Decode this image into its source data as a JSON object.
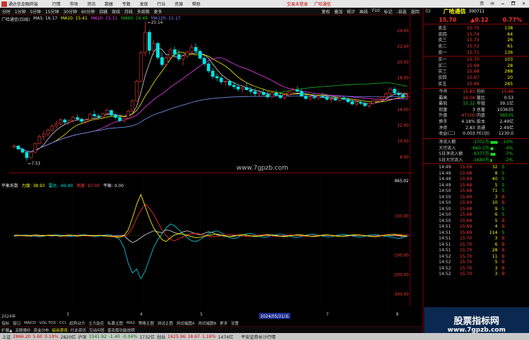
{
  "window": {
    "title": "通达信金融终端",
    "menu": [
      "行情",
      "市场",
      "资讯",
      "数据",
      "专题",
      "发现",
      "行业",
      "资源",
      "帮助"
    ],
    "center": [
      "交易未登录",
      "广哈通信"
    ],
    "controls": [
      "资",
      "✉",
      "🗕",
      "🗖",
      "✕"
    ]
  },
  "toolbar": {
    "items": [
      "分时",
      "1分钟",
      "5分钟",
      "15分钟",
      "30分钟",
      "60分钟",
      "日线",
      "周线",
      "月线",
      "多周期",
      "更多"
    ],
    "right": [
      "复权",
      "叠加",
      "统计",
      "画线",
      "F10",
      "标记",
      "-自选",
      "返回"
    ]
  },
  "main_chart_info": {
    "name": "广哈通信(日线)",
    "ma5": "MA5: 16.17",
    "ma10": "MA10: 15.41",
    "ma20": "MA20: 15.11",
    "ma60": "MA60: 16.49",
    "ma120": "MA120: 15.17",
    "high_label": "25.14",
    "low_label": "7.53",
    "watermark": "www.7gpzb.com",
    "ylabels": [
      "24.00",
      "22.00",
      "20.00",
      "18.00",
      "16.00",
      "14.00",
      "12.00",
      "10.00",
      "8.00"
    ]
  },
  "sub_chart_info": {
    "name": "平衡系数",
    "a_label": "力度: 38.93",
    "b_label": "雷达: -69.90",
    "c_label": "刺客: 97.00",
    "d_label": "平衡: 0.00",
    "ylabels": [
      "865.02",
      "100.00",
      "0.00",
      "-100.00",
      "-200.00",
      "-300.00"
    ]
  },
  "stock": {
    "number": "02",
    "name": "广哈通信",
    "code": "300711",
    "price": "15.70",
    "change": "▲0.12",
    "pct": "0.77%"
  },
  "asks": [
    {
      "label": "卖五",
      "price": "15.75",
      "vol": "138"
    },
    {
      "label": "卖四",
      "price": "15.74",
      "vol": "64"
    },
    {
      "label": "卖三",
      "price": "15.73",
      "vol": "26"
    },
    {
      "label": "卖二",
      "price": "15.72",
      "vol": "61"
    },
    {
      "label": "卖一",
      "price": "15.71",
      "vol": "136"
    }
  ],
  "bids": [
    {
      "label": "买一",
      "price": "15.70",
      "vol": "103"
    },
    {
      "label": "买二",
      "price": "15.69",
      "vol": "28"
    },
    {
      "label": "买三",
      "price": "15.68",
      "vol": "288"
    },
    {
      "label": "买四",
      "price": "15.67",
      "vol": "20"
    },
    {
      "label": "买五",
      "price": "15.66",
      "vol": "265"
    }
  ],
  "quote": [
    {
      "k1": "今开",
      "v1": "15.83",
      "k2": "均价",
      "v2": "15.66"
    },
    {
      "k1": "最高",
      "v1": "16.04",
      "k2": "量比",
      "v2": "0.53"
    },
    {
      "k1": "最低",
      "v1": "15.22",
      "k2": "市值",
      "v2": "39.1亿"
    },
    {
      "k1": "现量",
      "v1": "3",
      "k2": "总量",
      "v2": "103635"
    },
    {
      "k1": "外盘",
      "v1": "47100",
      "k2": "内盘",
      "v2": "56535"
    },
    {
      "k1": "换手",
      "v1": "4.18%",
      "k2": "股本",
      "v2": "2.49亿"
    },
    {
      "k1": "净资",
      "v1": "2.83",
      "k2": "流通",
      "v2": "2.49亿"
    },
    {
      "k1": "收益(二)",
      "v1": "0.003",
      "k2": "PE(动)",
      "v2": "1230.0"
    }
  ],
  "flows": [
    {
      "k": "净流入额",
      "v": "-1701万",
      "p": "-10%"
    },
    {
      "k": "大宗流入",
      "v": "-660.3万",
      "p": "-4%"
    },
    {
      "k": "5日净流入额",
      "v": "-6377万",
      "p": "-7%"
    },
    {
      "k": "5日大宗流入",
      "v": "-1680万",
      "p": "-2%"
    }
  ],
  "ticks": [
    {
      "t": "14:49",
      "p": "15.69",
      "v": "32",
      "s": "S"
    },
    {
      "t": "14:49",
      "p": "15.68",
      "v": "8",
      "s": "S"
    },
    {
      "t": "14:49",
      "p": "15.69",
      "v": "40",
      "s": "S"
    },
    {
      "t": "14:49",
      "p": "15.68",
      "v": "5",
      "s": "S"
    },
    {
      "t": "14:50",
      "p": "15.68",
      "v": "71",
      "s": "S"
    },
    {
      "t": "14:50",
      "p": "15.69",
      "v": "3",
      "s": "B"
    },
    {
      "t": "14:50",
      "p": "15.69",
      "v": "10",
      "s": "B"
    },
    {
      "t": "14:50",
      "p": "15.68",
      "v": "9",
      "s": "S"
    },
    {
      "t": "14:50",
      "p": "15.68",
      "v": "6",
      "s": "S"
    },
    {
      "t": "14:50",
      "p": "15.69",
      "v": "5",
      "s": "B"
    },
    {
      "t": "14:51",
      "p": "15.69",
      "v": "4",
      "s": "B"
    },
    {
      "t": "14:51",
      "p": "15.69",
      "v": "114",
      "s": "S"
    },
    {
      "t": "14:51",
      "p": "15.70",
      "v": "3",
      "s": "B"
    },
    {
      "t": "14:51",
      "p": "15.70",
      "v": "6",
      "s": "B"
    },
    {
      "t": "14:51",
      "p": "15.70",
      "v": "28",
      "s": "B"
    },
    {
      "t": "14:52",
      "p": "15.70",
      "v": "11",
      "s": "B"
    },
    {
      "t": "14:52",
      "p": "15.70",
      "v": "5",
      "s": "B"
    },
    {
      "t": "14:52",
      "p": "15.70",
      "v": "3",
      "s": "B"
    },
    {
      "t": "14:52",
      "p": "15.70",
      "v": "3",
      "s": "B"
    }
  ],
  "date_bar": {
    "year": "2024年",
    "m3": "3",
    "m4": "4",
    "m5": "5",
    "cursor_date": "2024/05/31/五",
    "m7": "7",
    "m8": "8"
  },
  "bottom_tabs": [
    "指标",
    "窗口",
    "MACD",
    "VOL-TDX",
    "CCI",
    "趋势动力",
    "主力监控",
    "私募主图",
    "MA2",
    "策略主图",
    "测试主图",
    "测式幅图A",
    "测式幅图B",
    "更多",
    "设置"
  ],
  "bottom_tabs2": [
    "扩展▲",
    "关联报价",
    "资金分布",
    "综合资讯",
    "行业资讯",
    "互动问答",
    "普及版功能说明"
  ],
  "status": {
    "sh_label": "上证",
    "sh_val": "2866.20",
    "sh_chg": "5.60",
    "sh_pct": "0.19%",
    "sh_amt": "2820亿",
    "sz_label": "沪深",
    "sz_val": "3341.92",
    "sz_chg": "-1.40",
    "sz_pct": "-0.04%",
    "sz_amt": "1732亿",
    "cy_label": "创业",
    "cy_val": "1625.96",
    "cy_chg": "18.67",
    "cy_pct": "1.16%",
    "cy_amt": "1474亿",
    "broker": "平安证券长沙行情"
  },
  "watermark": {
    "line1": "股票指标网",
    "line2": "www.7gpzb.com"
  },
  "chart_data": {
    "type": "line",
    "candles": [
      [
        9.3,
        9.6,
        9.0,
        9.4
      ],
      [
        9.4,
        9.5,
        8.9,
        9.0
      ],
      [
        9.0,
        9.2,
        8.4,
        8.6
      ],
      [
        8.6,
        8.8,
        7.53,
        7.9
      ],
      [
        7.9,
        8.7,
        7.8,
        8.6
      ],
      [
        8.6,
        9.8,
        8.5,
        9.7
      ],
      [
        9.7,
        10.8,
        9.6,
        10.6
      ],
      [
        10.6,
        11.3,
        10.2,
        10.9
      ],
      [
        10.9,
        11.6,
        10.6,
        11.4
      ],
      [
        11.4,
        12.1,
        11.2,
        11.9
      ],
      [
        11.9,
        12.6,
        11.7,
        12.2
      ],
      [
        12.2,
        12.9,
        12.0,
        12.7
      ],
      [
        12.7,
        12.9,
        12.2,
        12.4
      ],
      [
        12.4,
        12.8,
        12.1,
        12.6
      ],
      [
        12.6,
        13.2,
        12.4,
        13.0
      ],
      [
        13.0,
        13.4,
        12.6,
        12.8
      ],
      [
        12.8,
        13.0,
        12.3,
        12.5
      ],
      [
        12.5,
        12.9,
        12.2,
        12.7
      ],
      [
        12.7,
        13.6,
        12.6,
        13.4
      ],
      [
        13.4,
        13.9,
        13.0,
        13.2
      ],
      [
        13.2,
        13.5,
        12.9,
        13.1
      ],
      [
        13.1,
        13.6,
        13.0,
        13.5
      ],
      [
        13.5,
        14.2,
        13.3,
        13.9
      ],
      [
        13.9,
        14.0,
        13.1,
        13.3
      ],
      [
        13.3,
        13.6,
        12.8,
        13.0
      ],
      [
        13.0,
        13.4,
        12.4,
        12.6
      ],
      [
        12.6,
        13.1,
        12.3,
        12.9
      ],
      [
        12.9,
        14.0,
        12.8,
        13.8
      ],
      [
        13.8,
        15.3,
        13.7,
        15.1
      ],
      [
        15.1,
        17.8,
        15.0,
        17.6
      ],
      [
        17.6,
        21.4,
        17.5,
        21.2
      ],
      [
        21.2,
        25.14,
        20.8,
        23.8
      ],
      [
        23.8,
        24.1,
        21.0,
        21.5
      ],
      [
        21.5,
        22.8,
        20.9,
        22.4
      ],
      [
        22.4,
        22.6,
        20.3,
        20.6
      ],
      [
        20.6,
        21.3,
        19.4,
        19.7
      ],
      [
        19.7,
        20.8,
        19.5,
        20.6
      ],
      [
        20.6,
        21.9,
        20.4,
        21.6
      ],
      [
        21.6,
        22.0,
        20.7,
        21.0
      ],
      [
        21.0,
        21.6,
        20.1,
        20.4
      ],
      [
        20.4,
        21.0,
        19.6,
        20.8
      ],
      [
        20.8,
        21.5,
        20.5,
        21.3
      ],
      [
        21.3,
        22.3,
        21.0,
        21.9
      ],
      [
        21.9,
        22.4,
        21.1,
        21.4
      ],
      [
        21.4,
        21.7,
        20.3,
        20.5
      ],
      [
        20.5,
        20.9,
        19.5,
        19.8
      ],
      [
        19.8,
        20.1,
        18.6,
        18.9
      ],
      [
        18.9,
        19.3,
        17.9,
        18.2
      ],
      [
        18.2,
        18.6,
        17.6,
        18.0
      ],
      [
        18.0,
        18.3,
        17.2,
        17.5
      ],
      [
        17.5,
        17.9,
        17.0,
        17.6
      ],
      [
        17.6,
        17.8,
        16.9,
        17.1
      ],
      [
        17.1,
        17.5,
        16.6,
        16.9
      ],
      [
        16.9,
        17.2,
        16.3,
        16.6
      ],
      [
        16.6,
        17.0,
        16.2,
        16.8
      ],
      [
        16.8,
        17.4,
        16.5,
        16.5
      ],
      [
        16.5,
        16.9,
        16.0,
        16.3
      ],
      [
        16.3,
        16.7,
        15.7,
        16.0
      ],
      [
        16.0,
        16.4,
        15.6,
        16.2
      ],
      [
        16.2,
        16.6,
        15.8,
        15.9
      ],
      [
        15.9,
        16.3,
        15.4,
        15.6
      ],
      [
        15.6,
        16.2,
        15.5,
        16.1
      ],
      [
        16.1,
        16.5,
        15.7,
        15.8
      ],
      [
        15.8,
        16.2,
        15.4,
        15.5
      ],
      [
        15.5,
        16.0,
        15.3,
        15.9
      ],
      [
        15.9,
        16.4,
        15.6,
        16.2
      ],
      [
        16.2,
        16.8,
        15.9,
        16.5
      ],
      [
        16.5,
        17.0,
        16.2,
        16.3
      ],
      [
        16.3,
        16.6,
        15.6,
        15.7
      ],
      [
        15.7,
        16.0,
        15.2,
        15.4
      ],
      [
        15.4,
        15.8,
        15.1,
        15.6
      ],
      [
        15.6,
        16.0,
        15.3,
        15.5
      ],
      [
        15.5,
        15.9,
        15.2,
        15.7
      ],
      [
        15.7,
        16.1,
        15.5,
        15.6
      ],
      [
        15.6,
        15.8,
        15.1,
        15.3
      ],
      [
        15.3,
        15.6,
        14.9,
        15.4
      ],
      [
        15.4,
        15.7,
        15.1,
        15.2
      ],
      [
        15.2,
        15.6,
        15.0,
        15.5
      ],
      [
        15.5,
        15.8,
        15.2,
        15.3
      ],
      [
        15.3,
        15.5,
        14.8,
        15.0
      ],
      [
        15.0,
        15.3,
        14.6,
        14.7
      ],
      [
        14.7,
        15.1,
        14.4,
        14.9
      ],
      [
        14.9,
        15.2,
        14.6,
        14.8
      ],
      [
        14.8,
        15.0,
        14.3,
        14.5
      ],
      [
        14.5,
        14.9,
        14.2,
        14.8
      ],
      [
        14.8,
        15.2,
        14.6,
        15.1
      ],
      [
        15.1,
        15.5,
        14.9,
        15.3
      ],
      [
        15.3,
        15.7,
        15.1,
        15.6
      ],
      [
        15.6,
        16.2,
        15.5,
        16.0
      ],
      [
        16.0,
        16.9,
        15.8,
        16.6
      ],
      [
        16.6,
        16.9,
        15.9,
        16.1
      ],
      [
        16.1,
        16.4,
        15.5,
        15.9
      ],
      [
        15.9,
        16.1,
        15.3,
        15.6
      ],
      [
        15.6,
        16.04,
        15.22,
        15.7
      ]
    ],
    "osc": {
      "yellow": [
        2,
        3,
        1,
        -2,
        1,
        4,
        2,
        -1,
        3,
        2,
        0,
        -3,
        1,
        4,
        2,
        -2,
        1,
        3,
        0,
        -1,
        2,
        1,
        -2,
        -4,
        -6,
        -8,
        0,
        30,
        90,
        160,
        210,
        150,
        90,
        40,
        10,
        -20,
        -30,
        -10,
        5,
        10,
        8,
        2,
        -5,
        -10,
        -8,
        -3,
        2,
        6,
        9,
        4,
        -2,
        -5,
        -3,
        2,
        5,
        3,
        -1,
        -4,
        -2,
        3,
        6,
        4,
        0,
        -3,
        -5,
        -2,
        2,
        5,
        4,
        1,
        -2,
        -4,
        -1,
        3,
        5,
        2,
        -1,
        -3,
        -2,
        1,
        4,
        6,
        3,
        0,
        -3,
        -5,
        -4,
        0,
        3,
        6,
        8,
        5,
        1,
        -2
      ],
      "red": [
        1,
        0,
        -1,
        1,
        2,
        0,
        -2,
        -1,
        1,
        2,
        1,
        -1,
        -2,
        0,
        2,
        3,
        1,
        -1,
        -2,
        0,
        1,
        2,
        0,
        -2,
        -3,
        -5,
        -2,
        10,
        40,
        90,
        130,
        160,
        140,
        110,
        70,
        30,
        0,
        -20,
        -25,
        -15,
        -5,
        5,
        10,
        12,
        8,
        3,
        -2,
        -5,
        -4,
        0,
        3,
        5,
        4,
        1,
        -2,
        -3,
        -1,
        2,
        4,
        3,
        0,
        -2,
        -3,
        -1,
        2,
        4,
        3,
        1,
        -1,
        -3,
        -2,
        0,
        2,
        4,
        3,
        0,
        -2,
        -3,
        -1,
        1,
        3,
        4,
        2,
        0,
        -2,
        -3,
        -1,
        2,
        5,
        7,
        4,
        2,
        0,
        -1
      ],
      "cyan": [
        -3,
        -1,
        2,
        4,
        1,
        -3,
        -5,
        -2,
        1,
        3,
        5,
        2,
        -2,
        -4,
        -1,
        3,
        6,
        4,
        0,
        -3,
        -2,
        2,
        5,
        3,
        -5,
        -20,
        -60,
        -140,
        -190,
        -170,
        -220,
        -180,
        -120,
        -60,
        -20,
        10,
        40,
        60,
        50,
        30,
        10,
        -10,
        -25,
        -30,
        -20,
        -5,
        10,
        20,
        25,
        15,
        0,
        -10,
        -15,
        -8,
        3,
        10,
        12,
        5,
        -3,
        -8,
        -6,
        0,
        6,
        9,
        5,
        -1,
        -6,
        -8,
        -4,
        2,
        7,
        8,
        3,
        -2,
        -6,
        -5,
        0,
        5,
        7,
        4,
        -1,
        -5,
        -6,
        -2,
        3,
        6,
        5,
        0,
        -4,
        -6,
        -10,
        -15,
        -8,
        -3
      ],
      "white": [
        0,
        2,
        1,
        -1,
        -2,
        0,
        1,
        2,
        0,
        -1,
        1,
        2,
        1,
        0,
        -1,
        -2,
        0,
        1,
        2,
        1,
        0,
        -1,
        -2,
        -1,
        0,
        1,
        2,
        -20,
        -35,
        -25,
        -10,
        5,
        15,
        25,
        20,
        15,
        30,
        25,
        15,
        10,
        20,
        25,
        18,
        10,
        5,
        12,
        20,
        15,
        5,
        0,
        -3,
        -5,
        0,
        3,
        5,
        2,
        0,
        -3,
        -2,
        1,
        3,
        5,
        2,
        -1,
        -3,
        -1,
        2,
        4,
        3,
        0,
        -2,
        -3,
        -1,
        1,
        3,
        2,
        0,
        -2,
        -3,
        -1,
        1,
        2,
        3,
        1,
        -1,
        -2,
        0,
        2,
        3,
        1,
        0,
        -1,
        -2,
        -1
      ]
    }
  }
}
